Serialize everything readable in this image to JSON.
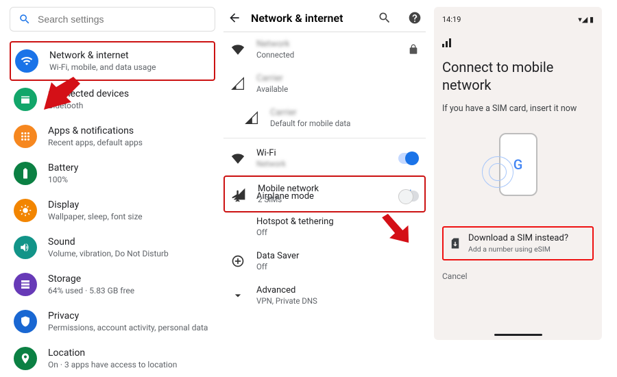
{
  "col1": {
    "search_placeholder": "Search settings",
    "items": [
      {
        "title": "Network & internet",
        "sub": "Wi-Fi, mobile, and data usage",
        "color": "#1a73e8",
        "highlight": true,
        "icon": "wifi"
      },
      {
        "title": "Connected devices",
        "sub": "Bluetooth",
        "color": "#12a66a",
        "icon": "devices"
      },
      {
        "title": "Apps & notifications",
        "sub": "Recent apps, default apps",
        "color": "#f6871f",
        "icon": "apps"
      },
      {
        "title": "Battery",
        "sub": "100%",
        "color": "#0b8043",
        "icon": "battery"
      },
      {
        "title": "Display",
        "sub": "Wallpaper, sleep, font size",
        "color": "#f28500",
        "icon": "display"
      },
      {
        "title": "Sound",
        "sub": "Volume, vibration, Do Not Disturb",
        "color": "#129488",
        "icon": "sound"
      },
      {
        "title": "Storage",
        "sub": "64% used · 5.83 GB free",
        "color": "#673ab7",
        "icon": "storage"
      },
      {
        "title": "Privacy",
        "sub": "Permissions, account activity, personal data",
        "color": "#1967d2",
        "icon": "privacy"
      },
      {
        "title": "Location",
        "sub": "On · 3 apps have access to location",
        "color": "#0b8043",
        "icon": "location"
      }
    ]
  },
  "col2": {
    "header": "Network & internet",
    "rows": [
      {
        "t1": "Network",
        "t2": "Connected",
        "icon": "wifi",
        "blurred_title": true,
        "lock": true
      },
      {
        "t1": "Carrier",
        "t2": "Available",
        "icon": "signal",
        "blurred_title": true
      },
      {
        "t1": "Carrier",
        "t2": "Default for mobile data",
        "icon": "signal",
        "blurred_title": true,
        "indent": true
      },
      {
        "t1": "Wi-Fi",
        "t2": "Network",
        "icon": "wifi",
        "blurred_sub": true,
        "switch": "on"
      },
      {
        "t1": "Mobile network",
        "t2": "2 SIMs",
        "icon": "signal-solid",
        "plus": true,
        "highlight": true
      },
      {
        "t1": "Airplane mode",
        "t2": "",
        "icon": "plane",
        "switch": "off"
      },
      {
        "t1": "Hotspot & tethering",
        "t2": "Off",
        "icon": ""
      },
      {
        "t1": "Data Saver",
        "t2": "Off",
        "icon": "datasaver"
      },
      {
        "t1": "Advanced",
        "t2": "VPN, Private DNS",
        "icon": "chevron"
      }
    ]
  },
  "col3": {
    "time": "14:19",
    "title": "Connect to mobile network",
    "sub": "If you have a SIM card, insert it now",
    "download_title": "Download a SIM instead?",
    "download_sub": "Add a number using eSIM",
    "cancel": "Cancel"
  }
}
